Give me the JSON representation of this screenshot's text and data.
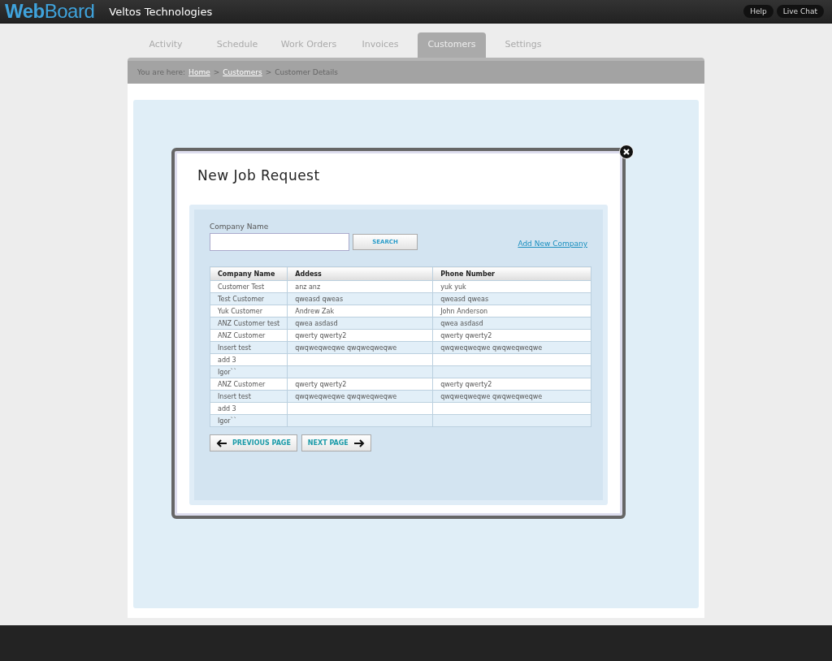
{
  "header": {
    "logo_part1": "Web",
    "logo_part2": "Board",
    "company": "Veltos Technologies",
    "buttons": [
      "Help",
      "Live Chat"
    ]
  },
  "tabs": [
    {
      "label": "Activity",
      "selected": false
    },
    {
      "label": "Schedule",
      "selected": false
    },
    {
      "label": "Work Orders",
      "selected": false
    },
    {
      "label": "Invoices",
      "selected": false
    },
    {
      "label": "Customers",
      "selected": true
    },
    {
      "label": "Settings",
      "selected": false
    }
  ],
  "breadcrumb": {
    "prefix": "You are here:",
    "links": [
      "Home",
      "Customers"
    ],
    "separator": ">",
    "current": "Customer Details"
  },
  "modal": {
    "title": "New Job Request",
    "field_label": "Company Name",
    "search_button": "SEARCH",
    "add_link": "Add New Company",
    "table": {
      "columns": [
        "Company Name",
        "Addess",
        "Phone Number"
      ],
      "rows": [
        [
          "Customer Test",
          "anz anz",
          "yuk yuk"
        ],
        [
          "Test Customer",
          "qweasd qweas",
          "qweasd qweas"
        ],
        [
          "Yuk Customer",
          "Andrew Zak",
          "John Anderson"
        ],
        [
          "ANZ Customer test",
          "qwea asdasd",
          "qwea asdasd"
        ],
        [
          "ANZ Customer",
          "qwerty qwerty2",
          "qwerty qwerty2"
        ],
        [
          "Insert test",
          "qwqweqweqwe qwqweqweqwe",
          "qwqweqweqwe qwqweqweqwe"
        ],
        [
          "add 3",
          "",
          ""
        ],
        [
          "Igor``",
          "",
          ""
        ],
        [
          "ANZ Customer",
          "qwerty qwerty2",
          "qwerty qwerty2"
        ],
        [
          "Insert test",
          "qwqweqweqwe qwqweqweqwe",
          "qwqweqweqwe qwqweqweqwe"
        ],
        [
          "add 3",
          "",
          ""
        ],
        [
          "Igor``",
          "",
          ""
        ]
      ]
    },
    "prev_button": "PREVIOUS PAGE",
    "next_button": "NEXT PAGE"
  }
}
